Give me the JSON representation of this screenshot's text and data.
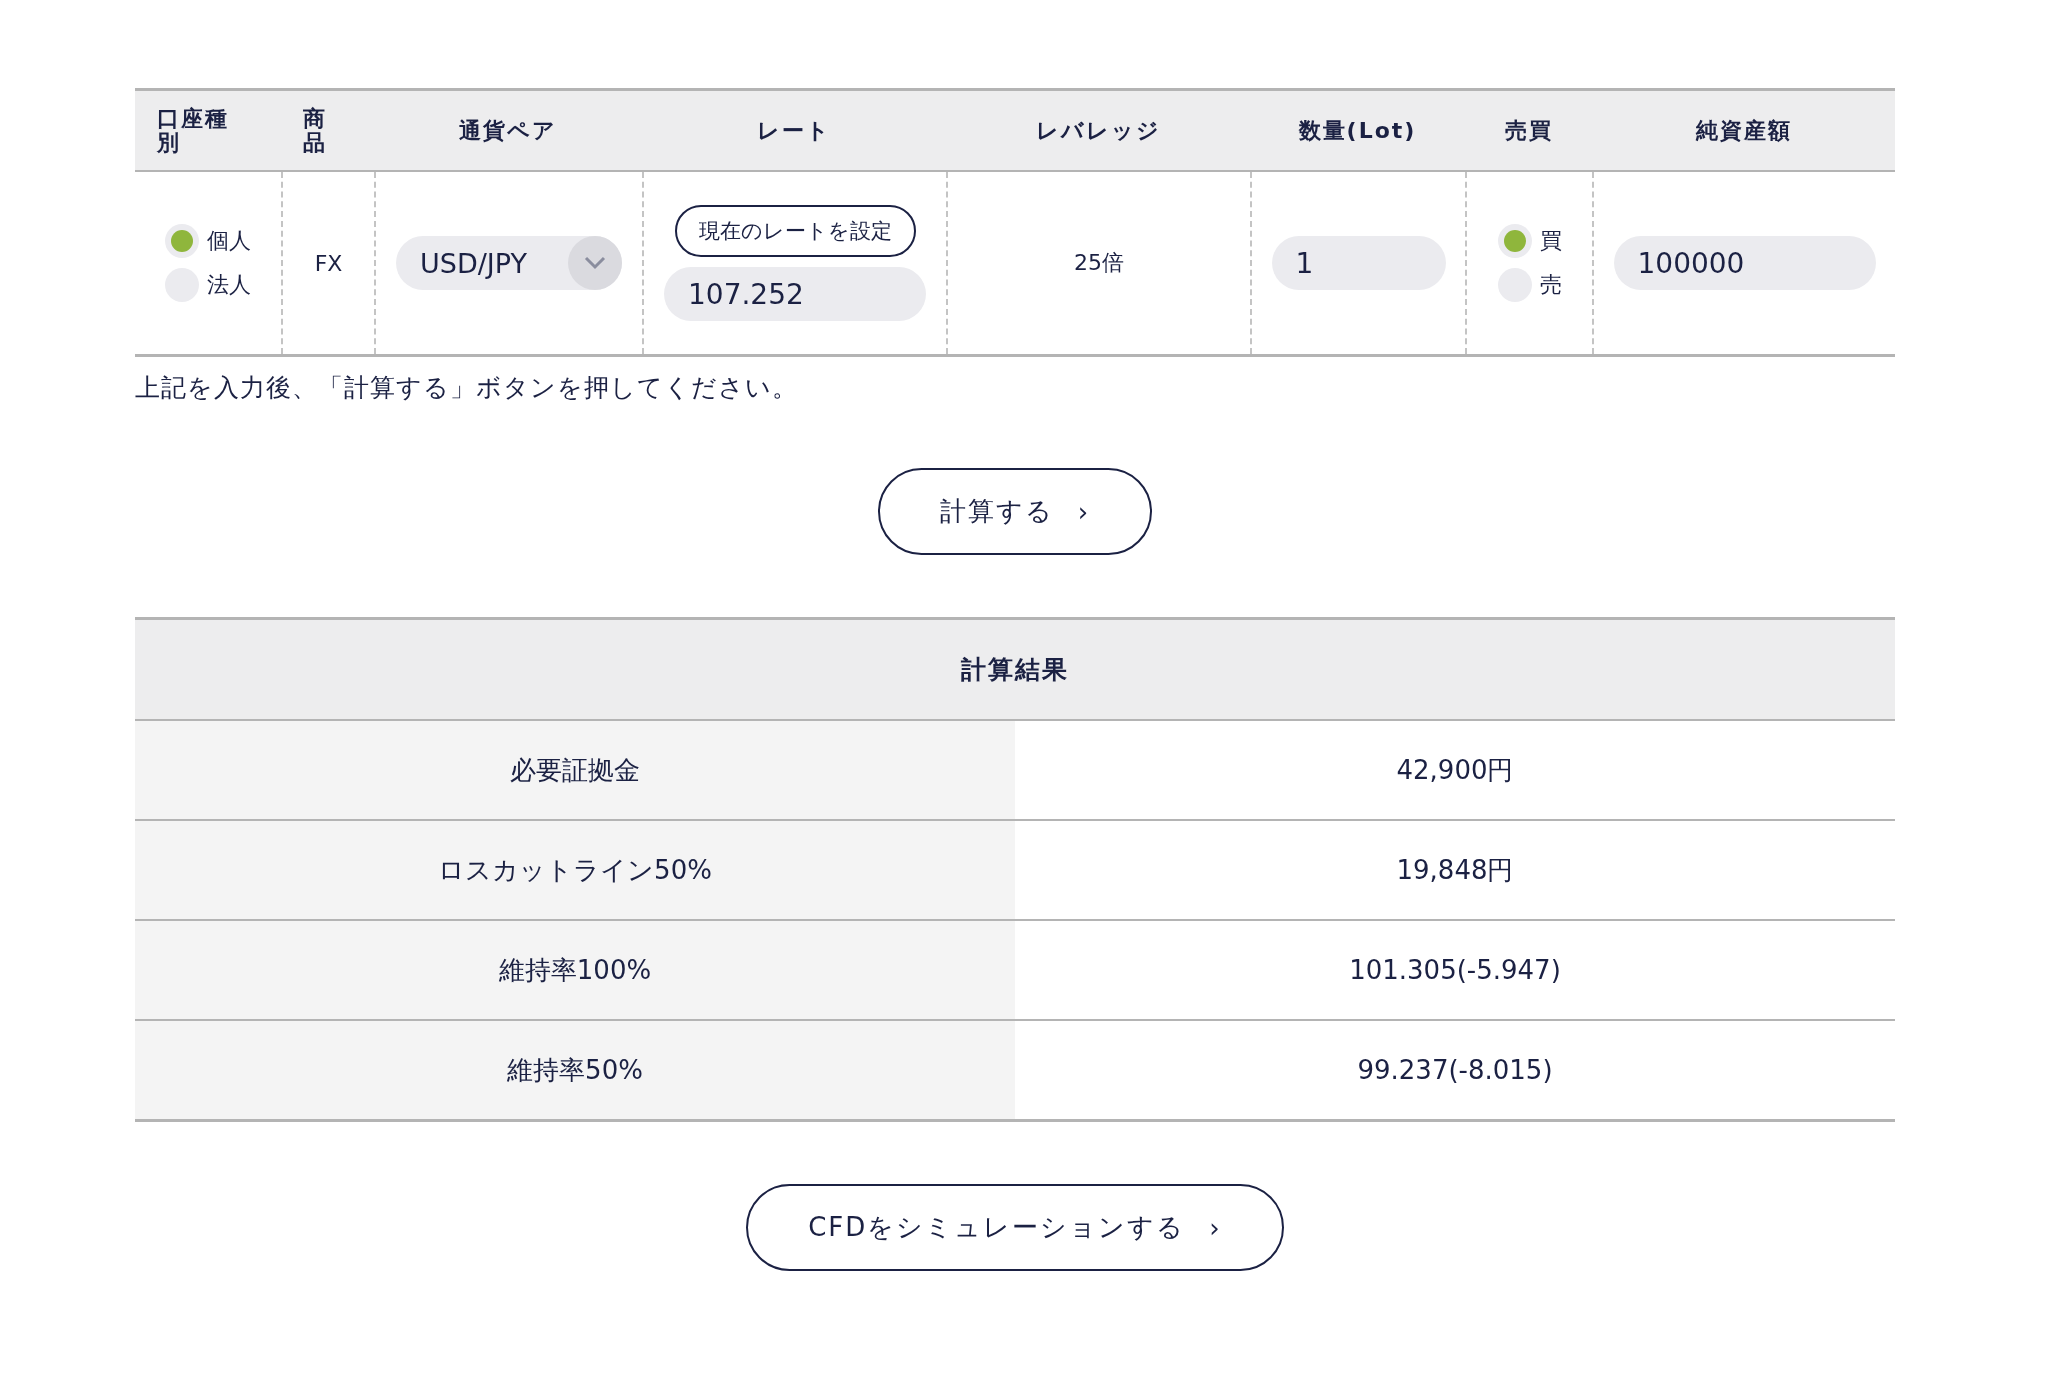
{
  "input_table": {
    "columns": [
      "口座種別",
      "商品",
      "通貨ペア",
      "レート",
      "レバレッジ",
      "数量(Lot)",
      "売買",
      "純資産額"
    ],
    "account_type": [
      {
        "label": "個人",
        "selected": true
      },
      {
        "label": "法人",
        "selected": false
      }
    ],
    "product": "FX",
    "currency_pair": {
      "value": "USD/JPY"
    },
    "set_rate_button": "現在のレートを設定",
    "rate": {
      "value": "107.252"
    },
    "leverage": "25倍",
    "lots": {
      "value": "1"
    },
    "side": [
      {
        "label": "買",
        "selected": true
      },
      {
        "label": "売",
        "selected": false
      }
    ],
    "net_assets": {
      "value": "100000"
    }
  },
  "note": "上記を入力後、「計算する」ボタンを押してください。",
  "calculate_button": {
    "label": "計算する",
    "arrow": "›"
  },
  "results": {
    "title": "計算結果",
    "rows": [
      {
        "label": "必要証拠金",
        "value": "42,900円"
      },
      {
        "label": "ロスカットライン50%",
        "value": "19,848円"
      },
      {
        "label": "維持率100%",
        "value": "101.305(-5.947)"
      },
      {
        "label": "維持率50%",
        "value": "99.237(-8.015)"
      }
    ]
  },
  "simulate_button": {
    "label": "CFDをシミュレーションする",
    "arrow": "›"
  }
}
